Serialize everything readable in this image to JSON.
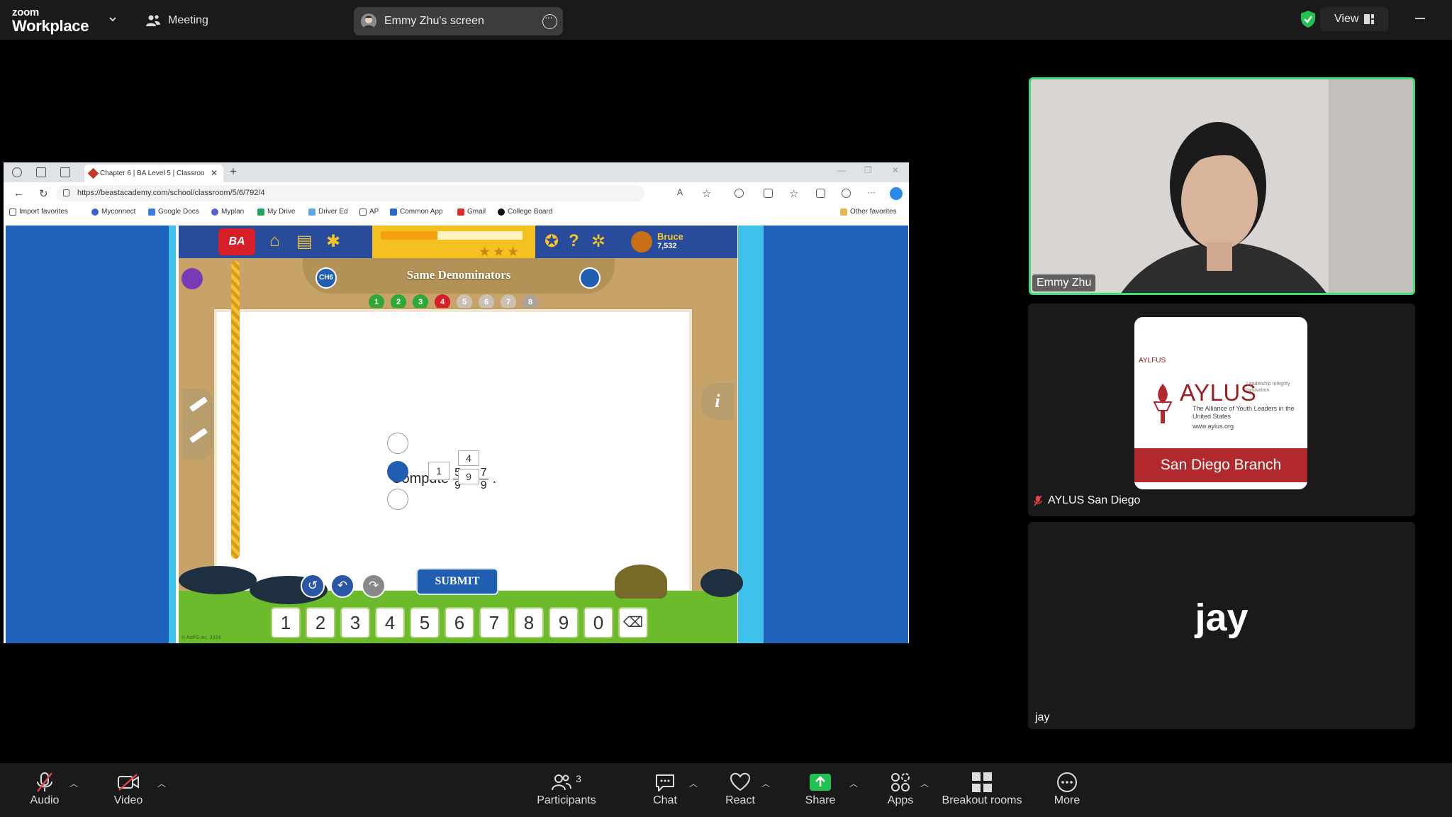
{
  "topbar": {
    "brand_small": "zoom",
    "brand_big": "Workplace",
    "meeting_label": "Meeting",
    "screen_label": "Emmy Zhu's screen",
    "view_label": "View"
  },
  "browser": {
    "tab_title": "Chapter 6 | BA Level 5 | Classroo",
    "url": "https://beastacademy.com/school/classroom/5/6/792/4",
    "bookmarks": [
      "Import favorites",
      "Myconnect",
      "Google Docs",
      "Myplan",
      "My Drive",
      "Driver Ed",
      "AP",
      "Common App",
      "Gmail",
      "College Board"
    ],
    "other_favorites": "Other favorites"
  },
  "game": {
    "logo": "BA",
    "lesson_title": "Same Denominators",
    "chapter_badge": "CH6",
    "user_name": "Bruce",
    "user_points": "7,532",
    "progress_fraction": 0.4,
    "stars": "★★★",
    "problem_dots": [
      "1",
      "2",
      "3",
      "4",
      "5",
      "6",
      "7",
      "8"
    ],
    "problem_prefix": "Compute",
    "frac1_num": "5",
    "frac1_den": "9",
    "plus": "+",
    "frac2_num": "7",
    "frac2_den": "9",
    "period": ".",
    "answer_whole": "1",
    "answer_num": "4",
    "answer_den": "9",
    "submit_label": "SUBMIT",
    "keys": [
      "1",
      "2",
      "3",
      "4",
      "5",
      "6",
      "7",
      "8",
      "9",
      "0"
    ],
    "backspace": "⌫",
    "info": "i",
    "copyright": "© AoPS Inc. 2024"
  },
  "participants": {
    "video_name": "Emmy Zhu",
    "aylus_name": "AYLUS San Diego",
    "aylus_small": "AYLFUS",
    "aylus_big": "AYLUS",
    "aylus_sub": "The Alliance of Youth Leaders in the United States",
    "aylus_url": "www.aylus.org",
    "aylus_tagline": "Leadership Integrity Innovation",
    "aylus_branch": "San Diego Branch",
    "jay_big": "jay",
    "jay_name": "jay"
  },
  "toolbar": {
    "audio": "Audio",
    "video": "Video",
    "participants": "Participants",
    "participant_count": "3",
    "chat": "Chat",
    "react": "React",
    "share": "Share",
    "apps": "Apps",
    "breakout": "Breakout rooms",
    "more": "More"
  },
  "colors": {
    "accent_green": "#3ddc74",
    "share_green": "#23c152",
    "ba_blue": "#1f5eb0",
    "ba_red": "#d71f2a",
    "aylus_red": "#b1282d"
  }
}
